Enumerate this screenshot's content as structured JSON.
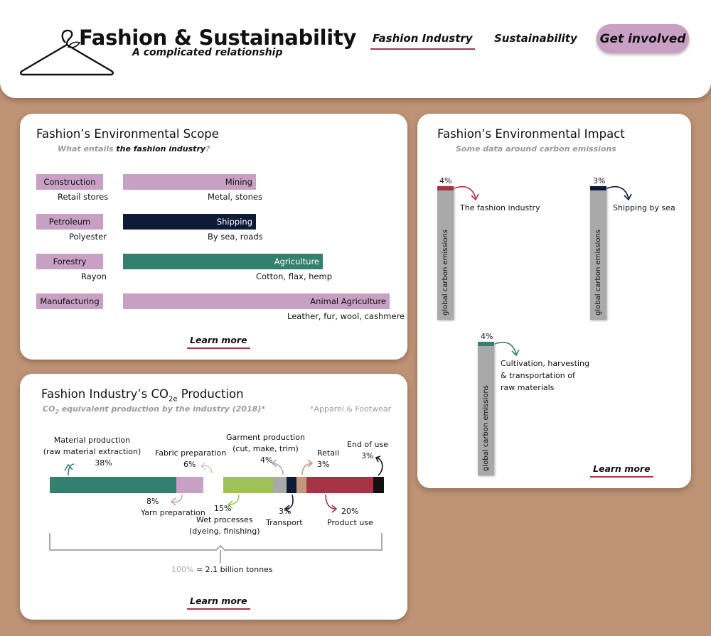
{
  "header": {
    "title": "Fashion & Sustainability",
    "subtitle": "A complicated relationship",
    "nav": [
      {
        "label": "Fashion Industry",
        "active": true
      },
      {
        "label": "Sustainability",
        "active": false
      }
    ],
    "cta_label": "Get involved"
  },
  "colors": {
    "pink": "#c7a0c4",
    "navy": "#0e1b38",
    "teal": "#34806f",
    "crimson": "#a63446",
    "gray": "#a9a9a9",
    "green": "#9fc15b",
    "tan": "#c4977c",
    "background": "#be9274"
  },
  "scope": {
    "title": "Fashion’s Environmental Scope",
    "subtitle_pre": "What entails ",
    "subtitle_bold": "the fashion industry",
    "subtitle_post": "?",
    "left": [
      {
        "label": "Construction",
        "sub": "Retail stores"
      },
      {
        "label": "Petroleum",
        "sub": "Polyester"
      },
      {
        "label": "Forestry",
        "sub": "Rayon"
      },
      {
        "label": "Manufacturing",
        "sub": "Leather, fur, wool, cashmere"
      }
    ],
    "right": [
      {
        "label": "Mining",
        "sub": "Metal, stones"
      },
      {
        "label": "Shipping",
        "sub": "By sea, roads"
      },
      {
        "label": "Agriculture",
        "sub": "Cotton, flax, hemp"
      },
      {
        "label": "Animal Agriculture",
        "sub": "Leather, fur, wool, cashmere"
      }
    ],
    "learn_more": "Learn more"
  },
  "impact": {
    "title": "Fashion’s Environmental Impact",
    "subtitle": "Some data around carbon emissions",
    "axis_label": "global carbon emissions",
    "bars": [
      {
        "pct": "4%",
        "label_lines": [
          "The fashion industry"
        ],
        "color": "#a63446"
      },
      {
        "pct": "3%",
        "label_lines": [
          "Shipping by sea"
        ],
        "color": "#0e1b38"
      },
      {
        "pct": "4%",
        "label_lines": [
          "Cultivation, harvesting",
          "& transportation of",
          "raw materials"
        ],
        "color": "#34806f"
      }
    ],
    "learn_more": "Learn more"
  },
  "co2": {
    "title_main": "Fashion Industry’s CO",
    "title_sub": "2e",
    "title_post": " Production",
    "subtitle_pre": "CO",
    "subtitle_sub": "2",
    "subtitle_post": " equivalent production by the industry (2018)*",
    "note": "*Apparel & Footwear",
    "total_pct": "100%",
    "total_text": " = 2.1 billion tonnes",
    "learn_more": "Learn more",
    "segments": [
      {
        "name": "Material production",
        "lines": [
          "Material production",
          "(raw material extraction)"
        ],
        "pct": "38%",
        "value": 38,
        "color": "#34806f"
      },
      {
        "name": "Yarn preparation",
        "lines": [
          "Yarn preparation"
        ],
        "pct": "8%",
        "value": 8,
        "color": "#c7a0c4"
      },
      {
        "name": "Fabric preparation",
        "lines": [
          "Fabric preparation"
        ],
        "pct": "6%",
        "value": 6,
        "color": "#ffffff"
      },
      {
        "name": "Wet processes",
        "lines": [
          "Wet processes",
          "(dyeing, finishing)"
        ],
        "pct": "15%",
        "value": 15,
        "color": "#9fc15b"
      },
      {
        "name": "Garment production",
        "lines": [
          "Garment production",
          "(cut, make, trim)"
        ],
        "pct": "4%",
        "value": 4,
        "color": "#a9a9a9"
      },
      {
        "name": "Transport",
        "lines": [
          "Transport"
        ],
        "pct": "3%",
        "value": 3,
        "color": "#0e1b38"
      },
      {
        "name": "Retail",
        "lines": [
          "Retail"
        ],
        "pct": "3%",
        "value": 3,
        "color": "#c4977c"
      },
      {
        "name": "Product use",
        "lines": [
          "Product use"
        ],
        "pct": "20%",
        "value": 20,
        "color": "#a63446"
      },
      {
        "name": "End of use",
        "lines": [
          "End of use"
        ],
        "pct": "3%",
        "value": 3,
        "color": "#111111"
      }
    ]
  }
}
